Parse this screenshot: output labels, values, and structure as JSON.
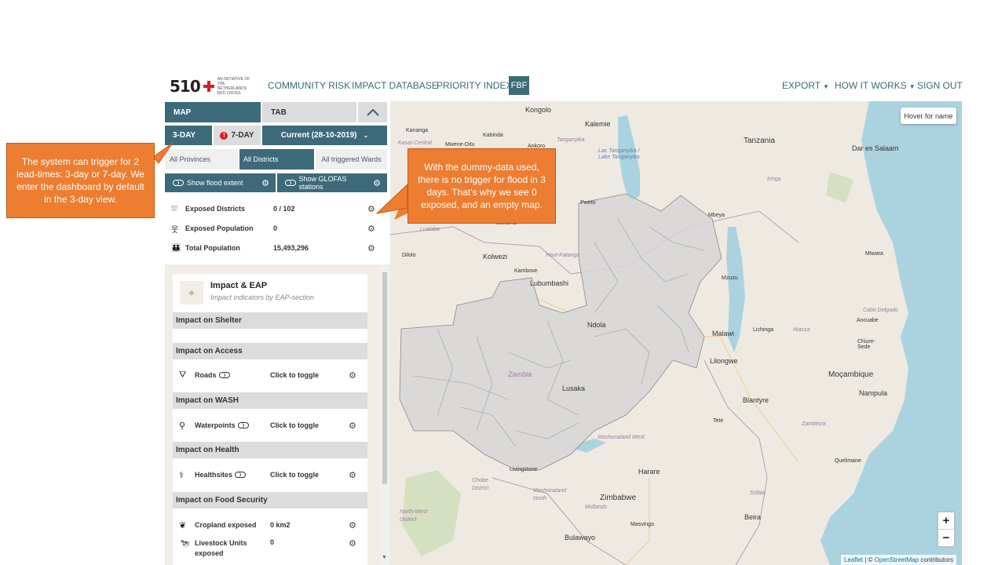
{
  "brand": {
    "logo_number": "510",
    "logo_text": "AN INITIATIVE OF THE NETHERLANDS RED CROSS"
  },
  "nav": {
    "community_risk": "COMMUNITY RISK",
    "impact_database": "IMPACT DATABASE",
    "priority_index": "PRIORITY INDEX",
    "fbf": "FBF",
    "export": "EXPORT",
    "how_it_works": "HOW IT WORKS",
    "sign_out": "SIGN OUT"
  },
  "panel": {
    "tabs": {
      "map": "MAP",
      "tab": "TAB"
    },
    "lead_times": {
      "three_day": "3-DAY",
      "seven_day": "7-DAY",
      "current": "Current (28-10-2019)"
    },
    "admin_levels": {
      "provinces": "All Provinces",
      "districts": "All Districts",
      "wards": "All triggered Wards"
    },
    "layers": {
      "flood_extent": "Show flood extent",
      "glofas": "Show GLOFAS stations"
    },
    "stats": [
      {
        "label": "Exposed Districts",
        "value": "0 / 102",
        "icon": "flood-icon"
      },
      {
        "label": "Exposed Population",
        "value": "0",
        "icon": "person-icon"
      },
      {
        "label": "Total Population",
        "value": "15,493,296",
        "icon": "people-icon"
      }
    ]
  },
  "impact": {
    "title": "Impact & EAP",
    "subtitle": "Impact indicators by EAP-section",
    "sections": {
      "shelter": "Impact on Shelter",
      "access": "Impact on Access",
      "wash": "Impact on WASH",
      "health": "Impact on Health",
      "food": "Impact on Food Security"
    },
    "indicators": {
      "roads": {
        "label": "Roads",
        "value": "Click to toggle"
      },
      "waterpoints": {
        "label": "Waterpoints",
        "value": "Click to toggle"
      },
      "healthsites": {
        "label": "Healthsites",
        "value": "Click to toggle"
      },
      "cropland": {
        "label": "Cropland exposed",
        "value": "0 km2"
      },
      "livestock": {
        "label": "Livestock Units exposed",
        "value": "0"
      }
    }
  },
  "map": {
    "hover_hint": "Hover for name",
    "zoom_in": "+",
    "zoom_out": "−",
    "attribution": {
      "leaflet": "Leaflet",
      "separator": " | © ",
      "osm": "OpenStreetMap",
      "contributors": " contributors"
    },
    "labels": {
      "kongolo": "Kongolo",
      "kalemie": "Kalemie",
      "kananga": "Kananga",
      "kasai": "Kasaï-Central",
      "mwene_ditu": "Mwene-Ditu",
      "kabinda": "Kabinda",
      "ankoro": "Ankoro",
      "tanganyika": "Tanganyika",
      "lake_tanganyika": "Lac Tanganyika / Lake Tanganyika",
      "tanzania": "Tanzania",
      "dar": "Dar es Salaam",
      "iringa": "Iringa",
      "pweto": "Pweto",
      "mbeya": "Mbeya",
      "bukama": "Bukama",
      "lualaba": "Lualaba",
      "dilolo": "Dilolo",
      "kolwezi": "Kolwezi",
      "haut_katanga": "Haut-Katanga",
      "kambove": "Kambove",
      "lubumbashi": "Lubumbashi",
      "mtwara": "Mtwara",
      "mzuzu": "Mzuzu",
      "ndola": "Ndola",
      "cabo_delgado": "Cabo Delgado",
      "ancuabe": "Ancuabe",
      "lichinga": "Lichinga",
      "malawi": "Malawi",
      "niassa": "Niassa",
      "chiure": "Chiure-Sede",
      "lilongwe": "Lilongwe",
      "mocambique": "Moçambique",
      "zambia": "Zambia",
      "lusaka": "Lusaka",
      "nampula": "Nampula",
      "blantyre": "Blantyre",
      "tete": "Tete",
      "zambezia": "Zambézia",
      "mashonaland": "Mashonaland West",
      "quelimane": "Quelimane",
      "livingstone": "Livingstone",
      "harare": "Harare",
      "chobe": "Chobe District",
      "mashonaland_c": "Mashonaland North",
      "zimbabwe": "Zimbabwe",
      "sofala": "Sofala",
      "north_west": "North-West District",
      "midlands": "Midlands",
      "masvingo": "Masvingo",
      "beira": "Beira",
      "bulawayo": "Bulawayo"
    }
  },
  "callouts": {
    "left": "The system can trigger for 2 lead-times: 3-day or 7-day. We enter the dashboard by default in the 3-day view.",
    "right": "With the dummy-data used, there is no trigger for flood in 3 days. That’s why we see 0 exposed, and an empty map."
  },
  "colors": {
    "accent": "#3d6a7a",
    "callout": "#ed7d31",
    "water": "#aad3df",
    "country_fill": "#d6d6d6"
  }
}
